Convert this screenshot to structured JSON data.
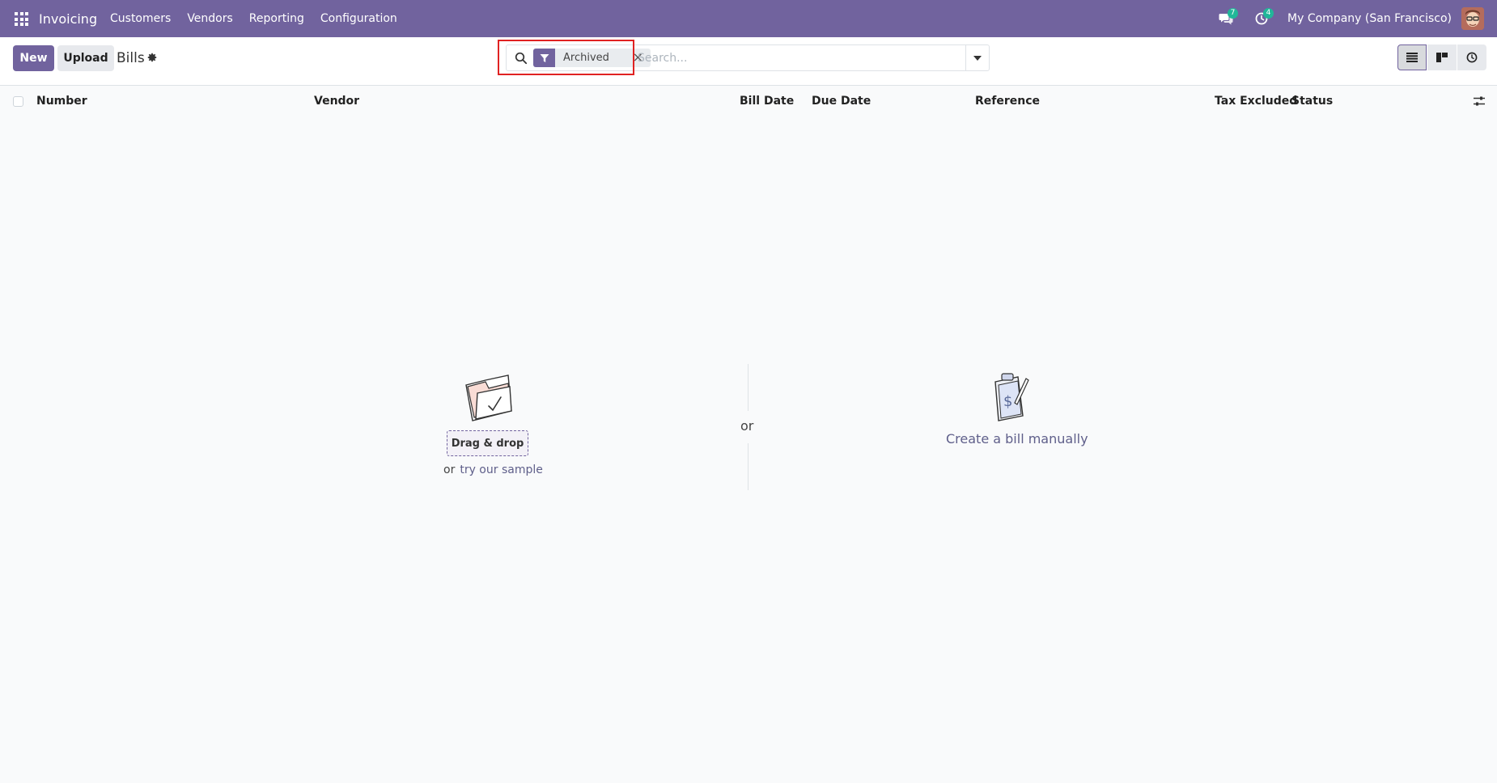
{
  "navbar": {
    "app_name": "Invoicing",
    "menu": [
      {
        "label": "Customers"
      },
      {
        "label": "Vendors"
      },
      {
        "label": "Reporting"
      },
      {
        "label": "Configuration"
      }
    ],
    "messages_count": "7",
    "activities_count": "4",
    "company": "My Company (San Francisco)",
    "bg_color": "#71639e"
  },
  "control": {
    "new_label": "New",
    "upload_label": "Upload",
    "title": "Bills"
  },
  "search": {
    "facet_label": "Archived",
    "facet_remove": "×",
    "placeholder": "Search..."
  },
  "table": {
    "columns": [
      {
        "label": "Number"
      },
      {
        "label": "Vendor"
      },
      {
        "label": "Bill Date"
      },
      {
        "label": "Due Date"
      },
      {
        "label": "Reference"
      },
      {
        "label": "Tax Excluded"
      },
      {
        "label": "Status"
      }
    ]
  },
  "empty": {
    "drag_drop": "Drag & drop",
    "or_small": "or",
    "try_sample": "try our sample",
    "or_mid": "or",
    "create_manual": "Create a bill manually"
  }
}
